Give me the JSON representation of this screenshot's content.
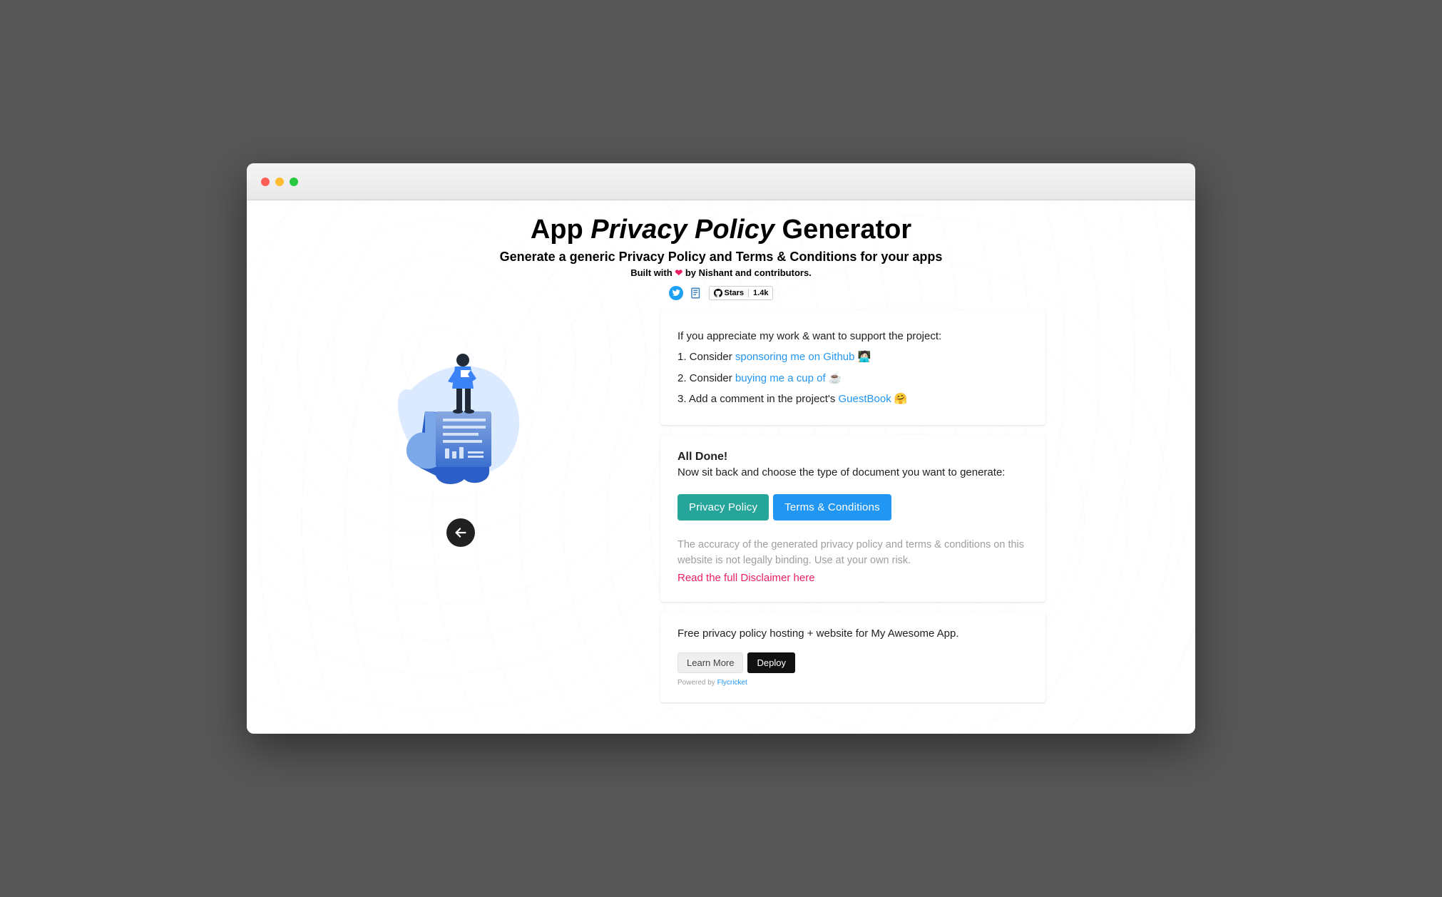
{
  "hero": {
    "title_pre": "App ",
    "title_ital": "Privacy Policy",
    "title_post": " Generator",
    "sub": "Generate a generic Privacy Policy and Terms & Conditions for your apps",
    "built_pre": "Built with ",
    "built_post": " by Nishant and contributors.",
    "gh_label": "Stars",
    "gh_count": "1.4k"
  },
  "support": {
    "intro": "If you appreciate my work & want to support the project:",
    "item1_pre": "1. Consider ",
    "item1_link": "sponsoring me on Github",
    "item1_post": " 🧑🏻‍💻",
    "item2_pre": "2. Consider ",
    "item2_link": "buying me a cup of",
    "item2_post": " ☕",
    "item3_pre": "3. Add a comment in the project's ",
    "item3_link": "GuestBook",
    "item3_post": " 🤗"
  },
  "done": {
    "title": "All Done!",
    "sub": "Now sit back and choose the type of document you want to generate:",
    "btn_privacy": "Privacy Policy",
    "btn_terms": "Terms & Conditions",
    "disc": "The accuracy of the generated privacy policy and terms & conditions on this website is not legally binding. Use at your own risk.",
    "disc_link": "Read the full Disclaimer here"
  },
  "hosting": {
    "text": "Free privacy policy hosting + website for My Awesome App.",
    "learn": "Learn More",
    "deploy": "Deploy",
    "powered_pre": "Powered by ",
    "powered_link": "Flycricket"
  }
}
